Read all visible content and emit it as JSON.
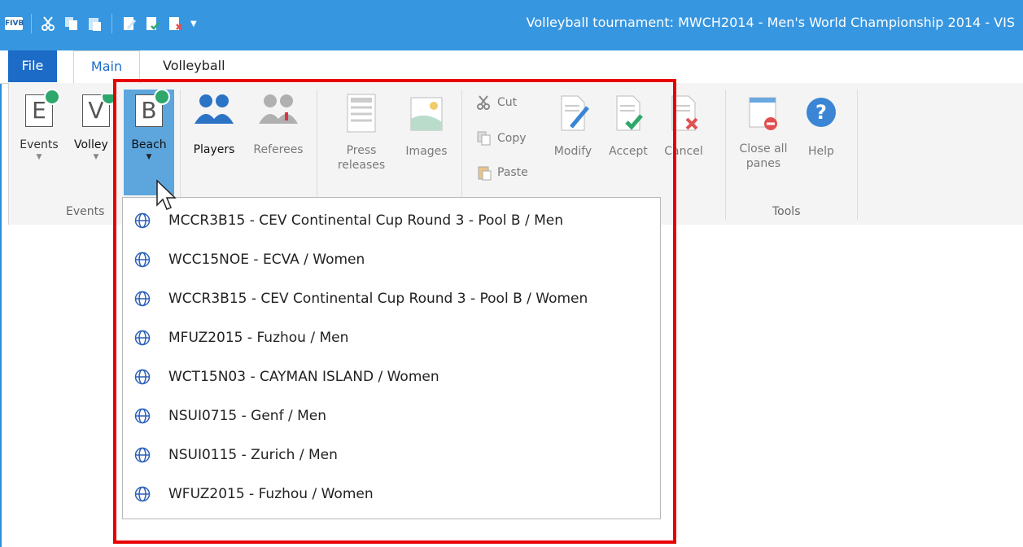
{
  "window": {
    "title": "Volleyball tournament: MWCH2014 - Men's World Championship 2014 - VIS",
    "logo_text": "FIVB"
  },
  "tabs": [
    {
      "label": "File"
    },
    {
      "label": "Main"
    },
    {
      "label": "Volleyball"
    }
  ],
  "ribbon": {
    "events_group": {
      "label": "Events",
      "buttons": {
        "events": "Events",
        "volley": "Volley",
        "beach": "Beach"
      }
    },
    "people": {
      "players": "Players",
      "referees": "Referees"
    },
    "media": {
      "press": "Press releases",
      "images": "Images"
    },
    "clipboard": {
      "cut": "Cut",
      "copy": "Copy",
      "paste": "Paste"
    },
    "edit": {
      "modify": "Modify",
      "accept": "Accept",
      "cancel": "Cancel"
    },
    "tools_group": {
      "label": "Tools",
      "close": "Close all panes",
      "help": "Help"
    }
  },
  "dropdown_items": [
    "MCCR3B15 - CEV Continental Cup Round 3 - Pool B / Men",
    "WCC15NOE - ECVA / Women",
    "WCCR3B15 - CEV Continental Cup Round 3 - Pool B / Women",
    "MFUZ2015 - Fuzhou / Men",
    "WCT15N03 - CAYMAN ISLAND / Women",
    "NSUI0715 - Genf / Men",
    "NSUI0115 - Zurich / Men",
    "WFUZ2015 - Fuzhou / Women"
  ],
  "colors": {
    "title_bar": "#3796e0",
    "file_tab": "#1c6bc6",
    "active_button": "#5da6dd",
    "highlight": "#e80000",
    "badge": "#2ea76b"
  }
}
